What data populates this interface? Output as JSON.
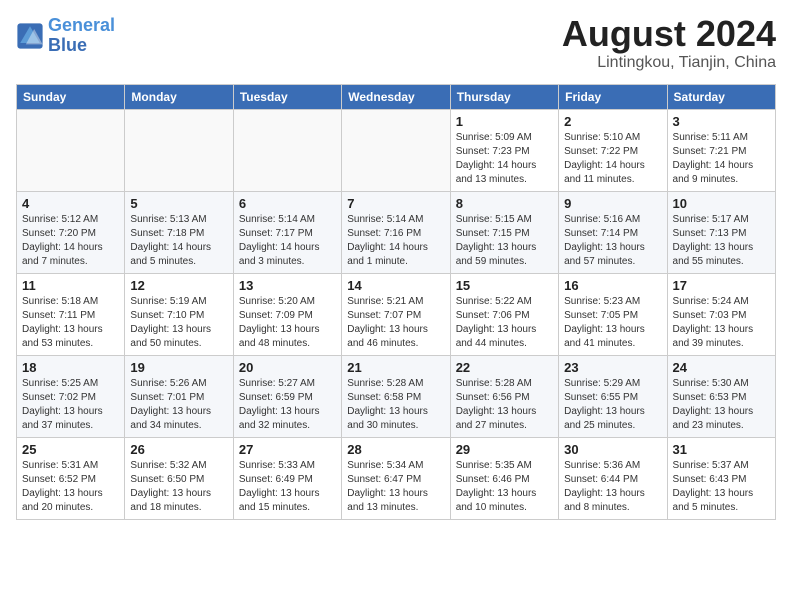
{
  "logo": {
    "line1": "General",
    "line2": "Blue"
  },
  "title": {
    "month_year": "August 2024",
    "location": "Lintingkou, Tianjin, China"
  },
  "weekdays": [
    "Sunday",
    "Monday",
    "Tuesday",
    "Wednesday",
    "Thursday",
    "Friday",
    "Saturday"
  ],
  "weeks": [
    [
      {
        "day": "",
        "info": ""
      },
      {
        "day": "",
        "info": ""
      },
      {
        "day": "",
        "info": ""
      },
      {
        "day": "",
        "info": ""
      },
      {
        "day": "1",
        "info": "Sunrise: 5:09 AM\nSunset: 7:23 PM\nDaylight: 14 hours\nand 13 minutes."
      },
      {
        "day": "2",
        "info": "Sunrise: 5:10 AM\nSunset: 7:22 PM\nDaylight: 14 hours\nand 11 minutes."
      },
      {
        "day": "3",
        "info": "Sunrise: 5:11 AM\nSunset: 7:21 PM\nDaylight: 14 hours\nand 9 minutes."
      }
    ],
    [
      {
        "day": "4",
        "info": "Sunrise: 5:12 AM\nSunset: 7:20 PM\nDaylight: 14 hours\nand 7 minutes."
      },
      {
        "day": "5",
        "info": "Sunrise: 5:13 AM\nSunset: 7:18 PM\nDaylight: 14 hours\nand 5 minutes."
      },
      {
        "day": "6",
        "info": "Sunrise: 5:14 AM\nSunset: 7:17 PM\nDaylight: 14 hours\nand 3 minutes."
      },
      {
        "day": "7",
        "info": "Sunrise: 5:14 AM\nSunset: 7:16 PM\nDaylight: 14 hours\nand 1 minute."
      },
      {
        "day": "8",
        "info": "Sunrise: 5:15 AM\nSunset: 7:15 PM\nDaylight: 13 hours\nand 59 minutes."
      },
      {
        "day": "9",
        "info": "Sunrise: 5:16 AM\nSunset: 7:14 PM\nDaylight: 13 hours\nand 57 minutes."
      },
      {
        "day": "10",
        "info": "Sunrise: 5:17 AM\nSunset: 7:13 PM\nDaylight: 13 hours\nand 55 minutes."
      }
    ],
    [
      {
        "day": "11",
        "info": "Sunrise: 5:18 AM\nSunset: 7:11 PM\nDaylight: 13 hours\nand 53 minutes."
      },
      {
        "day": "12",
        "info": "Sunrise: 5:19 AM\nSunset: 7:10 PM\nDaylight: 13 hours\nand 50 minutes."
      },
      {
        "day": "13",
        "info": "Sunrise: 5:20 AM\nSunset: 7:09 PM\nDaylight: 13 hours\nand 48 minutes."
      },
      {
        "day": "14",
        "info": "Sunrise: 5:21 AM\nSunset: 7:07 PM\nDaylight: 13 hours\nand 46 minutes."
      },
      {
        "day": "15",
        "info": "Sunrise: 5:22 AM\nSunset: 7:06 PM\nDaylight: 13 hours\nand 44 minutes."
      },
      {
        "day": "16",
        "info": "Sunrise: 5:23 AM\nSunset: 7:05 PM\nDaylight: 13 hours\nand 41 minutes."
      },
      {
        "day": "17",
        "info": "Sunrise: 5:24 AM\nSunset: 7:03 PM\nDaylight: 13 hours\nand 39 minutes."
      }
    ],
    [
      {
        "day": "18",
        "info": "Sunrise: 5:25 AM\nSunset: 7:02 PM\nDaylight: 13 hours\nand 37 minutes."
      },
      {
        "day": "19",
        "info": "Sunrise: 5:26 AM\nSunset: 7:01 PM\nDaylight: 13 hours\nand 34 minutes."
      },
      {
        "day": "20",
        "info": "Sunrise: 5:27 AM\nSunset: 6:59 PM\nDaylight: 13 hours\nand 32 minutes."
      },
      {
        "day": "21",
        "info": "Sunrise: 5:28 AM\nSunset: 6:58 PM\nDaylight: 13 hours\nand 30 minutes."
      },
      {
        "day": "22",
        "info": "Sunrise: 5:28 AM\nSunset: 6:56 PM\nDaylight: 13 hours\nand 27 minutes."
      },
      {
        "day": "23",
        "info": "Sunrise: 5:29 AM\nSunset: 6:55 PM\nDaylight: 13 hours\nand 25 minutes."
      },
      {
        "day": "24",
        "info": "Sunrise: 5:30 AM\nSunset: 6:53 PM\nDaylight: 13 hours\nand 23 minutes."
      }
    ],
    [
      {
        "day": "25",
        "info": "Sunrise: 5:31 AM\nSunset: 6:52 PM\nDaylight: 13 hours\nand 20 minutes."
      },
      {
        "day": "26",
        "info": "Sunrise: 5:32 AM\nSunset: 6:50 PM\nDaylight: 13 hours\nand 18 minutes."
      },
      {
        "day": "27",
        "info": "Sunrise: 5:33 AM\nSunset: 6:49 PM\nDaylight: 13 hours\nand 15 minutes."
      },
      {
        "day": "28",
        "info": "Sunrise: 5:34 AM\nSunset: 6:47 PM\nDaylight: 13 hours\nand 13 minutes."
      },
      {
        "day": "29",
        "info": "Sunrise: 5:35 AM\nSunset: 6:46 PM\nDaylight: 13 hours\nand 10 minutes."
      },
      {
        "day": "30",
        "info": "Sunrise: 5:36 AM\nSunset: 6:44 PM\nDaylight: 13 hours\nand 8 minutes."
      },
      {
        "day": "31",
        "info": "Sunrise: 5:37 AM\nSunset: 6:43 PM\nDaylight: 13 hours\nand 5 minutes."
      }
    ]
  ]
}
